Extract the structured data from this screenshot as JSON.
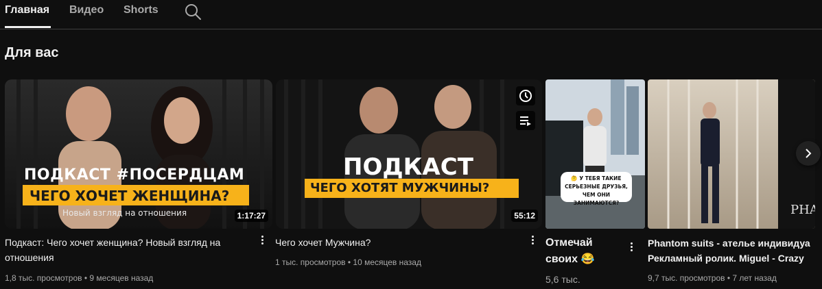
{
  "tabs": [
    {
      "label": "Главная"
    },
    {
      "label": "Видео"
    },
    {
      "label": "Shorts"
    }
  ],
  "section_title": "Для вас",
  "videos": [
    {
      "title": "Подкаст: Чего хочет женщина? Новый взгляд на отношения",
      "meta": "1,8 тыс. просмотров • 9 месяцев назад",
      "duration": "1:17:27",
      "thumb_text": {
        "line1": "ПОДКАСТ #ПОСЕРДЦАМ",
        "line2": "ЧЕГО ХОЧЕТ ЖЕНЩИНА?",
        "line3": "Новый взгляд на отношения"
      }
    },
    {
      "title": "Чего хочет Мужчина?",
      "meta": "1 тыс. просмотров • 10 месяцев назад",
      "duration": "55:12",
      "thumb_text": {
        "line1": "ПОДКАСТ",
        "line2": "ЧЕГО ХОТЯТ МУЖЧИНЫ?"
      }
    },
    {
      "title_line1": "Отмечай",
      "title_line2": "своих 😂",
      "meta": "5,6 тыс.",
      "thumb_text": {
        "caption": "🤔 У ТЕБЯ ТАКИЕ СЕРЬЕЗНЫЕ ДРУЗЬЯ, ЧЕМ ОНИ ЗАНИМАЮТСЯ?"
      }
    },
    {
      "title_line1": "Phantom suits - ателье индивидуа",
      "title_line2": "Рекламный ролик. Miguel - Crazy",
      "meta": "9,7 тыс. просмотров • 7 лет назад",
      "thumb_text": {
        "brand": "PHAN"
      }
    }
  ],
  "icons": {
    "search": "search-icon",
    "more": "more-vert-icon",
    "watch_later": "clock-icon",
    "add_queue": "queue-icon",
    "next": "chevron-right-icon"
  },
  "colors": {
    "background": "#0f0f0f",
    "text": "#f1f1f1",
    "secondary": "#aaaaaa",
    "banner_yellow": "#f7b21a"
  }
}
